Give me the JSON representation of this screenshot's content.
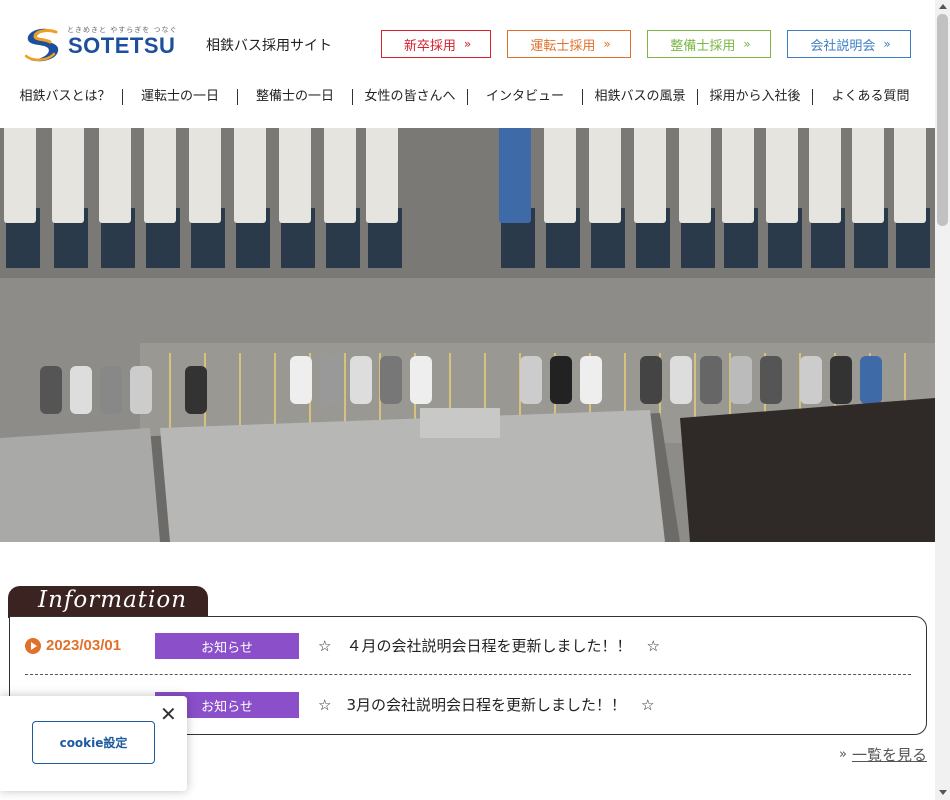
{
  "header": {
    "logo_tagline": "ときめきと やすらぎを つなぐ",
    "logo_text": "SOTETSU",
    "site_name": "相鉄バス採用サイト",
    "buttons": [
      {
        "label": "新卒採用",
        "icon": "double-chevron-right-icon",
        "color": "#d8202c"
      },
      {
        "label": "運転士採用",
        "icon": "double-chevron-right-icon",
        "color": "#e0712b"
      },
      {
        "label": "整備士採用",
        "icon": "double-chevron-right-icon",
        "color": "#7bb543"
      },
      {
        "label": "会社説明会",
        "icon": "double-chevron-right-icon",
        "color": "#3b7fc4"
      }
    ],
    "chevron": "»"
  },
  "nav": {
    "items": [
      {
        "label": "相鉄バスとは？"
      },
      {
        "label": "運転士の一日"
      },
      {
        "label": "整備士の一日"
      },
      {
        "label": "女性の皆さんへ"
      },
      {
        "label": "インタビュー"
      },
      {
        "label": "相鉄バスの風景"
      },
      {
        "label": "採用から入社後"
      },
      {
        "label": "よくある質問"
      }
    ]
  },
  "hero": {
    "image": "aerial-bus-depot-photo"
  },
  "information": {
    "heading": "Information",
    "items": [
      {
        "date": "2023/03/01",
        "category": "お知らせ",
        "title": "☆　４月の会社説明会日程を更新しました！！　☆"
      },
      {
        "date": "",
        "category": "お知らせ",
        "title": "☆　3月の会社説明会日程を更新しました！！　☆"
      }
    ],
    "more_label": "一覧を見る",
    "more_chevron": "»"
  },
  "cookie": {
    "close_icon": "close-icon",
    "close_glyph": "✕",
    "button_label": "cookie設定"
  },
  "colors": {
    "brand_blue": "#1e4f9c",
    "accent_orange": "#e0712b",
    "category_purple": "#8a4fc9",
    "info_tab_brown": "#3b2321"
  }
}
